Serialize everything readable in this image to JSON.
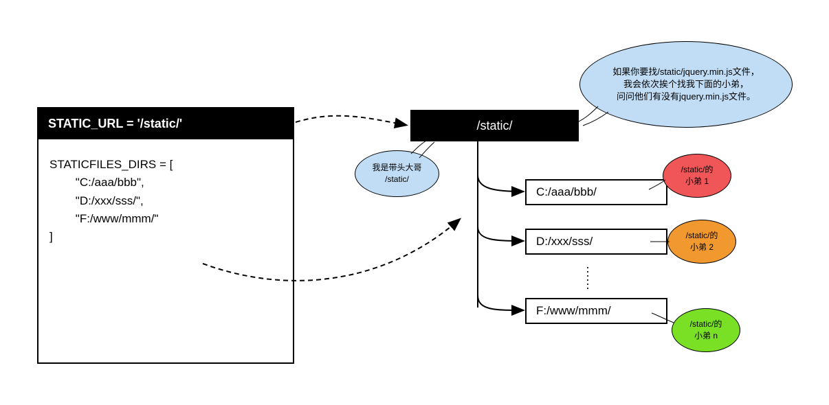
{
  "code": {
    "header": "STATIC_URL = '/static/'",
    "body": "STATICFILES_DIRS = [\n        \"C:/aaa/bbb\",\n        \"D:/xxx/sss/\",\n        \"F:/www/mmm/\"\n]"
  },
  "static_node": "/static/",
  "dirs": {
    "d1": "C:/aaa/bbb/",
    "d2": "D:/xxx/sss/",
    "d3": "F:/www/mmm/"
  },
  "callouts": {
    "big_blue": "如果你要找/static/jquery.min.js文件，\n我会依次挨个找我下面的小弟，\n问问他们有没有jquery.min.js文件。",
    "small_blue": "我是带头大哥\n/static/",
    "red": "/static/的\n小弟 1",
    "orange": "/static/的\n小弟 2",
    "green": "/static/的\n小弟 n"
  }
}
